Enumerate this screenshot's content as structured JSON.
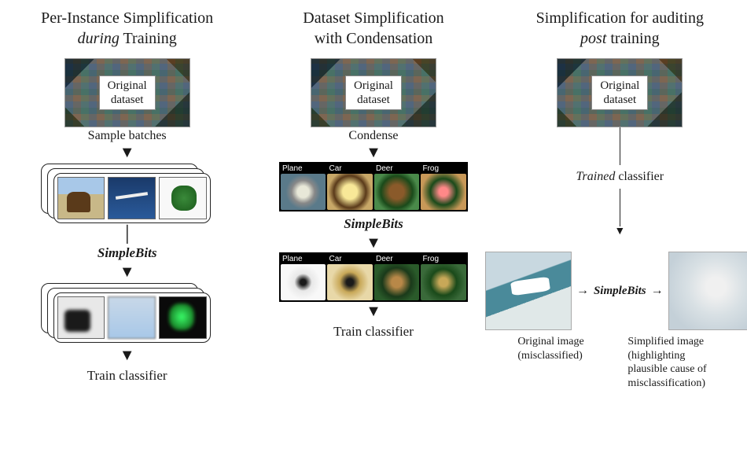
{
  "columns": [
    {
      "title_line1": "Per-Instance Simplification",
      "title_line2_italic_word": "during",
      "title_line2_rest": " Training",
      "dataset_label_line1": "Original",
      "dataset_label_line2": "dataset",
      "step1_label": "Sample batches",
      "method_label": "SimpleBits",
      "final_label": "Train classifier"
    },
    {
      "title_line1": "Dataset Simplification",
      "title_line2": "with Condensation",
      "dataset_label_line1": "Original",
      "dataset_label_line2": "dataset",
      "step1_label": "Condense",
      "condensed_labels": [
        "Plane",
        "Car",
        "Deer",
        "Frog"
      ],
      "method_label": "SimpleBits",
      "final_label": "Train classifier"
    },
    {
      "title_line1": "Simplification for auditing",
      "title_line2_italic_word": "post",
      "title_line2_rest": " training",
      "dataset_label_line1": "Original",
      "dataset_label_line2": "dataset",
      "trained_label_italic": "Trained",
      "trained_label_rest": " classifier",
      "method_label": "SimpleBits",
      "caption_left_line1": "Original image",
      "caption_left_line2": "(misclassified)",
      "caption_right_line1": "Simplified image",
      "caption_right_line2": "(highlighting",
      "caption_right_line3": "plausible cause of",
      "caption_right_line4": "misclassification)"
    }
  ]
}
